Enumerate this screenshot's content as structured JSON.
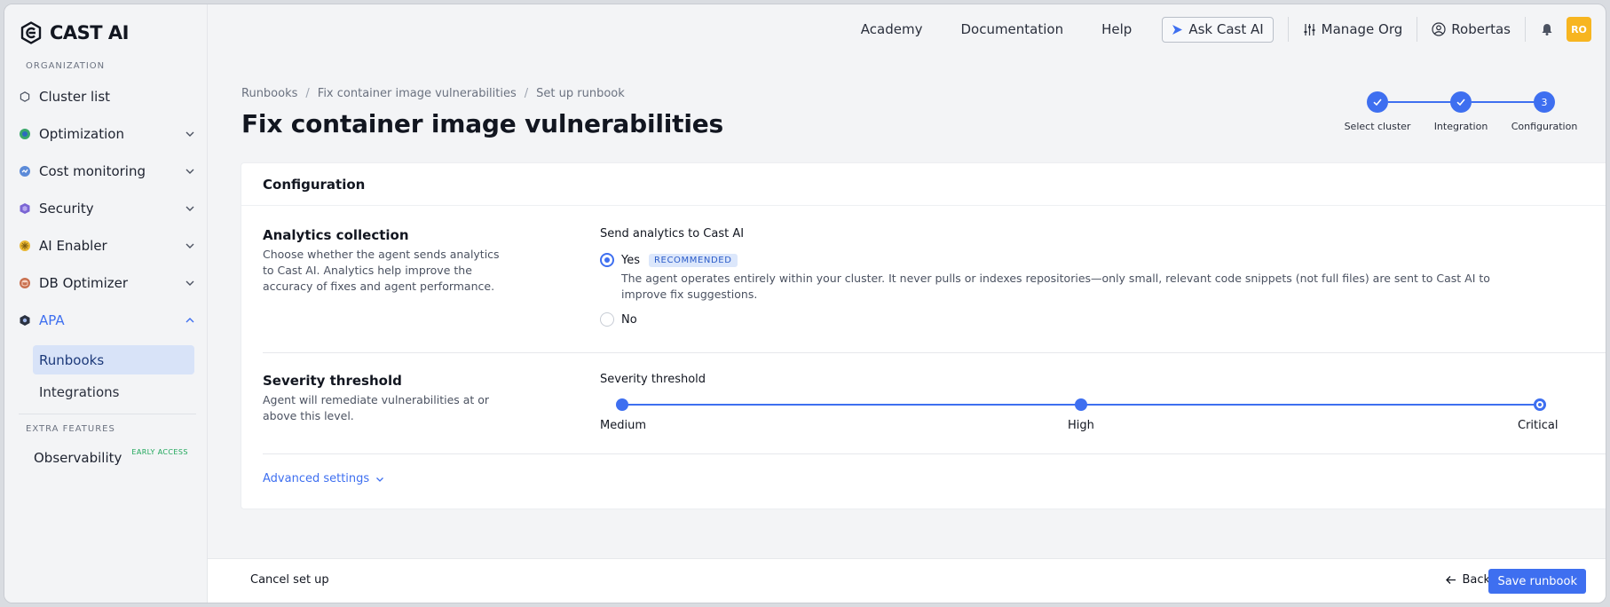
{
  "brand": {
    "name": "CAST AI",
    "accent": "#3e6ff0"
  },
  "sidebar": {
    "org_label": "ORGANIZATION",
    "items": [
      {
        "label": "Cluster list",
        "icon": "hexagon-icon"
      },
      {
        "label": "Optimization",
        "icon": "optimization-icon"
      },
      {
        "label": "Cost monitoring",
        "icon": "cost-monitoring-icon"
      },
      {
        "label": "Security",
        "icon": "security-shield-icon"
      },
      {
        "label": "AI Enabler",
        "icon": "ai-enabler-icon"
      },
      {
        "label": "DB Optimizer",
        "icon": "db-optimizer-icon"
      },
      {
        "label": "APA",
        "icon": "apa-icon"
      }
    ],
    "apa_children": [
      {
        "label": "Runbooks",
        "selected": true
      },
      {
        "label": "Integrations",
        "selected": false
      }
    ],
    "extra_label": "EXTRA FEATURES",
    "observability": {
      "label": "Observability",
      "badge": "EARLY ACCESS"
    }
  },
  "topbar": {
    "academy": "Academy",
    "documentation": "Documentation",
    "help": "Help",
    "ask": "Ask Cast AI",
    "manage_org": "Manage Org",
    "user": "Robertas",
    "avatar_initials": "RO"
  },
  "breadcrumb": [
    "Runbooks",
    "Fix container image vulnerabilities",
    "Set up runbook"
  ],
  "page_title": "Fix container image vulnerabilities",
  "stepper": {
    "steps": [
      {
        "label": "Select cluster",
        "state": "done"
      },
      {
        "label": "Integration",
        "state": "done"
      },
      {
        "label": "Configuration",
        "state": "current",
        "number": "3"
      }
    ]
  },
  "card": {
    "title": "Configuration",
    "analytics": {
      "title": "Analytics collection",
      "description": "Choose whether the agent sends analytics to Cast AI. Analytics help improve the accuracy of fixes and agent performance.",
      "field_label": "Send analytics to Cast AI",
      "yes_label": "Yes",
      "recommended_badge": "RECOMMENDED",
      "yes_help": "The agent operates entirely within your cluster. It never pulls or indexes repositories—only small, relevant code snippets (not full files) are sent to Cast AI to improve fix suggestions.",
      "no_label": "No",
      "selected": "yes"
    },
    "severity": {
      "title": "Severity threshold",
      "description": "Agent will remediate vulnerabilities at or above this level.",
      "field_label": "Severity threshold",
      "levels": [
        "Medium",
        "High",
        "Critical"
      ],
      "selected": "Critical"
    },
    "advanced_settings": "Advanced settings"
  },
  "footer": {
    "cancel": "Cancel set up",
    "back": "Back",
    "save": "Save runbook"
  }
}
